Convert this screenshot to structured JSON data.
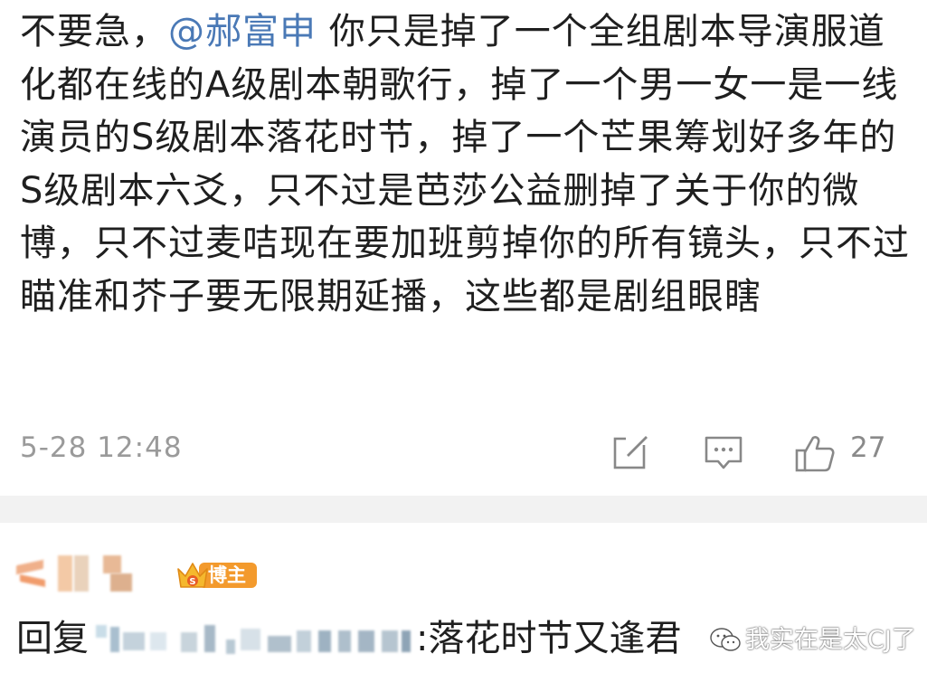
{
  "comment": {
    "text_before_mention": "不要急，",
    "mention": "@郝富申",
    "text_after_mention": " 你只是掉了一个全组剧本导演服道化都在线的A级剧本朝歌行，掉了一个男一女一是一线演员的S级剧本落花时节，掉了一个芒果筹划好多年的S级剧本六爻，只不过是芭莎公益删掉了关于你的微博，只不过麦咭现在要加班剪掉你的所有镜头，只不过瞄准和芥子要无限期延播，这些都是剧组眼瞎",
    "timestamp": "5-28 12:48",
    "like_count": "27",
    "icons": [
      "edit-icon",
      "reply-icon",
      "like-icon"
    ]
  },
  "reply": {
    "badge_label": "博主",
    "prefix": "回复",
    "text": ":落花时节又逢君",
    "icons": [
      "crown-icon"
    ]
  },
  "watermark": {
    "text": "我实在是太CJ了",
    "icon": "wechat-icon"
  },
  "colors": {
    "mention": "#4a79b6",
    "badge": "#f39a2d",
    "separator": "#f2f2f2",
    "meta_text": "#9a9a9a"
  }
}
